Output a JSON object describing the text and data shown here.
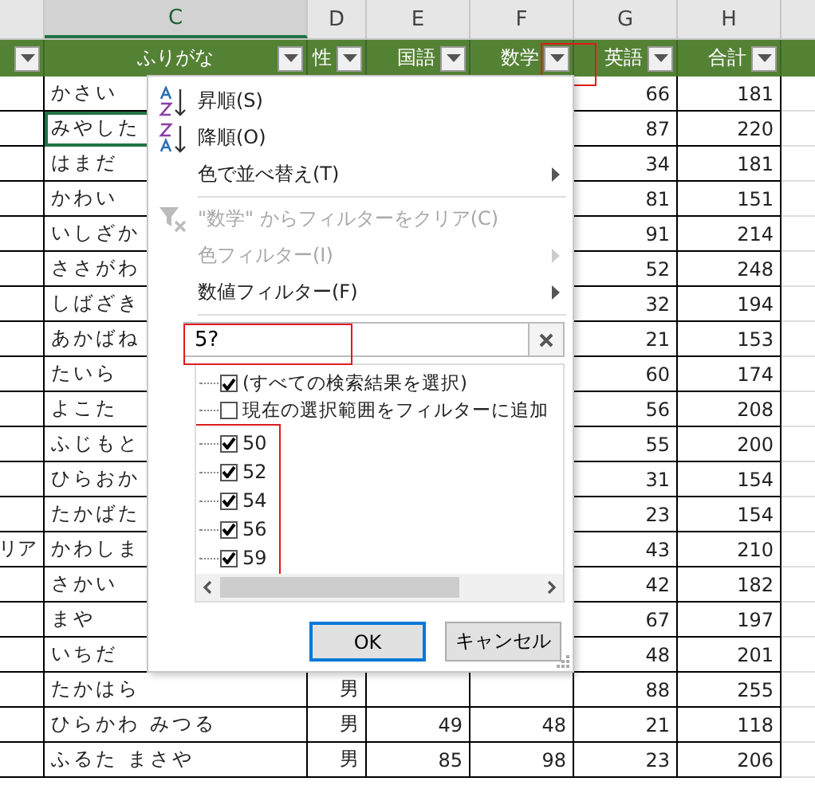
{
  "columns": [
    {
      "letter": "C",
      "selected": true
    },
    {
      "letter": "D",
      "selected": false
    },
    {
      "letter": "E",
      "selected": false
    },
    {
      "letter": "F",
      "selected": false
    },
    {
      "letter": "G",
      "selected": false
    },
    {
      "letter": "H",
      "selected": false
    }
  ],
  "headers": [
    "ふりがな",
    "性",
    "国語",
    "数学",
    "英語",
    "合計"
  ],
  "rows": [
    {
      "c": "かさい",
      "g": "66",
      "h": "181",
      "active": false
    },
    {
      "c": "みやした",
      "g": "87",
      "h": "220",
      "active": true
    },
    {
      "c": "はまだ",
      "g": "34",
      "h": "181",
      "active": false
    },
    {
      "c": "かわい",
      "g": "81",
      "h": "151",
      "active": false
    },
    {
      "c": "いしざか",
      "g": "91",
      "h": "214",
      "active": false
    },
    {
      "c": "ささがわ",
      "g": "52",
      "h": "248",
      "active": false
    },
    {
      "c": "しばざき",
      "g": "32",
      "h": "194",
      "active": false
    },
    {
      "c": "あかばね",
      "g": "21",
      "h": "153",
      "active": false
    },
    {
      "c": "たいら",
      "g": "60",
      "h": "174",
      "active": false
    },
    {
      "c": "よこた",
      "g": "56",
      "h": "208",
      "active": false
    },
    {
      "c": "ふじもと",
      "g": "55",
      "h": "200",
      "active": false
    },
    {
      "c": "ひらおか",
      "g": "31",
      "h": "154",
      "active": false
    },
    {
      "c": "たかばた",
      "g": "23",
      "h": "154",
      "active": false
    },
    {
      "b": "リア",
      "c": "かわしま",
      "g": "43",
      "h": "210",
      "active": false
    },
    {
      "c": "さかい",
      "g": "42",
      "h": "182",
      "active": false
    },
    {
      "c": "まや",
      "g": "67",
      "h": "197",
      "active": false
    },
    {
      "c": "いちだ",
      "g": "48",
      "h": "201",
      "active": false
    },
    {
      "c": "たかはら",
      "d": "男",
      "g": "88",
      "h": "255",
      "active": false
    },
    {
      "c": "ひらかわ みつる",
      "d": "男",
      "e": "49",
      "f": "48",
      "g": "21",
      "h": "118",
      "active": false
    },
    {
      "c": "ふるた まさや",
      "d": "男",
      "e": "85",
      "f": "98",
      "g": "23",
      "h": "206",
      "active": false
    }
  ],
  "filter_menu": {
    "items": [
      {
        "kind": "sort-asc",
        "label": "昇順(S)",
        "disabled": false,
        "submenu": false
      },
      {
        "kind": "sort-desc",
        "label": "降順(O)",
        "disabled": false,
        "submenu": false
      },
      {
        "kind": "plain",
        "label": "色で並べ替え(T)",
        "disabled": false,
        "submenu": true
      },
      {
        "kind": "separator"
      },
      {
        "kind": "clear",
        "label": "\"数学\" からフィルターをクリア(C)",
        "disabled": true,
        "submenu": false
      },
      {
        "kind": "plain",
        "label": "色フィルター(I)",
        "disabled": true,
        "submenu": true
      },
      {
        "kind": "plain",
        "label": "数値フィルター(F)",
        "disabled": false,
        "submenu": true
      }
    ],
    "search": {
      "value": "5?"
    },
    "list": [
      {
        "label": "(すべての検索結果を選択)",
        "checked": true,
        "kind": "option"
      },
      {
        "label": "現在の選択範囲をフィルターに追加",
        "checked": false,
        "kind": "option"
      },
      {
        "label": "50",
        "checked": true,
        "kind": "value"
      },
      {
        "label": "52",
        "checked": true,
        "kind": "value"
      },
      {
        "label": "54",
        "checked": true,
        "kind": "value"
      },
      {
        "label": "56",
        "checked": true,
        "kind": "value"
      },
      {
        "label": "59",
        "checked": true,
        "kind": "value"
      }
    ],
    "buttons": [
      "OK",
      "キャンセル"
    ]
  }
}
